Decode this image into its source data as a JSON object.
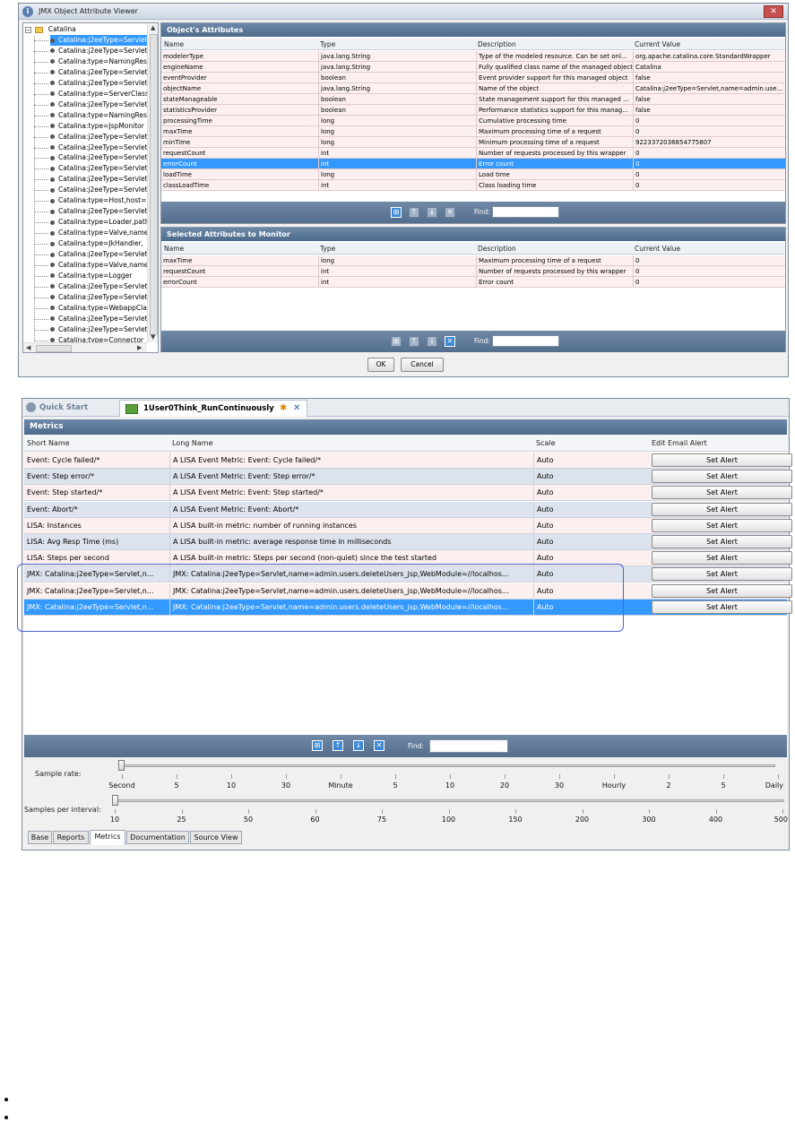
{
  "dialog": {
    "title": "JMX Object Attribute Viewer",
    "close_label": "✕",
    "tree": {
      "root": "Catalina",
      "items": [
        "Catalina:j2eeType=Servlet",
        "Catalina:j2eeType=Servlet",
        "Catalina:type=NamingResources",
        "Catalina:j2eeType=Servlet",
        "Catalina:j2eeType=Servlet",
        "Catalina:type=ServerClassLoader",
        "Catalina:j2eeType=Servlet",
        "Catalina:type=NamingResources",
        "Catalina:type=JspMonitor",
        "Catalina:j2eeType=Servlet",
        "Catalina:j2eeType=Servlet",
        "Catalina:j2eeType=Servlet",
        "Catalina:j2eeType=Servlet",
        "Catalina:j2eeType=Servlet",
        "Catalina:j2eeType=Servlet",
        "Catalina:type=Host,host=",
        "Catalina:j2eeType=Servlet",
        "Catalina:type=Loader,path",
        "Catalina:type=Valve,name",
        "Catalina:type=JkHandler,",
        "Catalina:j2eeType=Servlet",
        "Catalina:type=Valve,name",
        "Catalina:type=Logger",
        "Catalina:j2eeType=Servlet",
        "Catalina:j2eeType=Servlet",
        "Catalina:type=WebappClassLoader",
        "Catalina:j2eeType=Servlet",
        "Catalina:j2eeType=Servlet",
        "Catalina:type=Connector"
      ]
    },
    "attributes_panel": {
      "title": "Object's Attributes",
      "columns": [
        "Name",
        "Type",
        "Description",
        "Current Value"
      ],
      "rows": [
        [
          "modelerType",
          "java.lang.String",
          "Type of the modeled resource. Can be set onl...",
          "org.apache.catalina.core.StandardWrapper"
        ],
        [
          "engineName",
          "java.lang.String",
          "Fully qualified class name of the managed object",
          "Catalina"
        ],
        [
          "eventProvider",
          "boolean",
          "Event provider support for this managed object",
          "false"
        ],
        [
          "objectName",
          "java.lang.String",
          "Name of the object",
          "Catalina:j2eeType=Servlet,name=admin.use..."
        ],
        [
          "stateManageable",
          "boolean",
          "State management support for this managed ...",
          "false"
        ],
        [
          "statisticsProvider",
          "boolean",
          "Performance statistics support for this manag...",
          "false"
        ],
        [
          "processingTime",
          "long",
          "Cumulative processing time",
          "0"
        ],
        [
          "maxTime",
          "long",
          "Maximum processing time of a request",
          "0"
        ],
        [
          "minTime",
          "long",
          "Minimum processing time of a request",
          "9223372036854775807"
        ],
        [
          "requestCount",
          "int",
          "Number of requests processed by this wrapper",
          "0"
        ],
        [
          "errorCount",
          "int",
          "Error count",
          "0"
        ],
        [
          "loadTime",
          "long",
          "Load time",
          "0"
        ],
        [
          "classLoadTime",
          "int",
          "Class loading time",
          "0"
        ]
      ],
      "find_label": "Find:"
    },
    "monitor_panel": {
      "title": "Selected Attributes to Monitor",
      "columns": [
        "Name",
        "Type",
        "Description",
        "Current Value"
      ],
      "rows": [
        [
          "maxTime",
          "long",
          "Maximum processing time of a request",
          "0"
        ],
        [
          "requestCount",
          "int",
          "Number of requests processed by this wrapper",
          "0"
        ],
        [
          "errorCount",
          "int",
          "Error count",
          "0"
        ]
      ],
      "find_label": "Find:"
    },
    "ok_label": "OK",
    "cancel_label": "Cancel"
  },
  "app": {
    "quick_start_label": "Quick Start",
    "doc_tab_label": "1User0Think_RunContinuously",
    "doc_tab_modified": "✱",
    "doc_tab_close": "✕",
    "metrics_title": "Metrics",
    "columns": [
      "Short Name",
      "Long Name",
      "Scale",
      "Edit Email Alert"
    ],
    "rows": [
      [
        "Event: Cycle failed/*",
        "A LISA Event Metric: Event: Cycle failed/*",
        "Auto",
        "Set Alert"
      ],
      [
        "Event: Step error/*",
        "A LISA Event Metric: Event: Step error/*",
        "Auto",
        "Set Alert"
      ],
      [
        "Event: Step started/*",
        "A LISA Event Metric: Event: Step started/*",
        "Auto",
        "Set Alert"
      ],
      [
        "Event: Abort/*",
        "A LISA Event Metric: Event: Abort/*",
        "Auto",
        "Set Alert"
      ],
      [
        "LISA: Instances",
        "A LISA built-in metric: number of running instances",
        "Auto",
        "Set Alert"
      ],
      [
        "LISA: Avg Resp Time (ms)",
        "A LISA built-in metric: average response time in milliseconds",
        "Auto",
        "Set Alert"
      ],
      [
        "LISA: Steps per second",
        "A LISA built-in metric: Steps per second (non-quiet) since the test started",
        "Auto",
        "Set Alert"
      ],
      [
        "JMX:  Catalina:j2eeType=Servlet,n...",
        "JMX:  Catalina:j2eeType=Servlet,name=admin.users.deleteUsers_jsp,WebModule=//localhos...",
        "Auto",
        "Set Alert"
      ],
      [
        "JMX:  Catalina:j2eeType=Servlet,n...",
        "JMX:  Catalina:j2eeType=Servlet,name=admin.users.deleteUsers_jsp,WebModule=//localhos...",
        "Auto",
        "Set Alert"
      ],
      [
        "JMX:  Catalina:j2eeType=Servlet,n...",
        "JMX:  Catalina:j2eeType=Servlet,name=admin.users.deleteUsers_jsp,WebModule=//localhos...",
        "Auto",
        "Set Alert"
      ]
    ],
    "find_label": "Find:",
    "sample_rate": {
      "label": "Sample rate:",
      "ticks": [
        "Second",
        "5",
        "10",
        "30",
        "Minute",
        "5",
        "10",
        "20",
        "30",
        "Hourly",
        "2",
        "5",
        "Daily"
      ],
      "value_index": 0
    },
    "samples_per_interval": {
      "label": "Samples per interval:",
      "ticks": [
        "10",
        "25",
        "50",
        "60",
        "75",
        "100",
        "150",
        "200",
        "300",
        "400",
        "500"
      ],
      "value_index": 0
    },
    "bottom_tabs": [
      "Base",
      "Reports",
      "Metrics",
      "Documentation",
      "Source View"
    ],
    "active_bottom_tab": "Metrics"
  },
  "colors": {
    "panel_header": "#4d6a8b",
    "selection": "#3399ff",
    "highlight_border": "#4a66d0"
  }
}
